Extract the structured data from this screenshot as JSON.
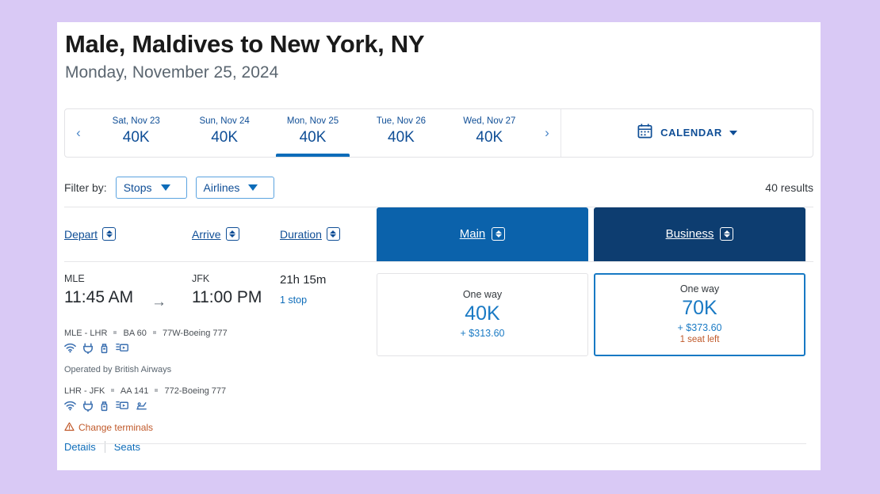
{
  "header": {
    "title": "Male, Maldives to New York, NY",
    "subtitle": "Monday, November 25, 2024"
  },
  "date_strip": {
    "prev_label": "‹",
    "next_label": "›",
    "days": [
      {
        "label": "Sat, Nov 23",
        "price": "40K",
        "selected": false
      },
      {
        "label": "Sun, Nov 24",
        "price": "40K",
        "selected": false
      },
      {
        "label": "Mon, Nov 25",
        "price": "40K",
        "selected": true
      },
      {
        "label": "Tue, Nov 26",
        "price": "40K",
        "selected": false
      },
      {
        "label": "Wed, Nov 27",
        "price": "40K",
        "selected": false
      }
    ],
    "calendar_label": "CALENDAR"
  },
  "filters": {
    "label": "Filter by:",
    "stops_label": "Stops",
    "airlines_label": "Airlines",
    "results_count": "40 results"
  },
  "columns": {
    "depart": "Depart",
    "arrive": "Arrive",
    "duration": "Duration",
    "main": "Main",
    "business": "Business"
  },
  "flight": {
    "depart_code": "MLE",
    "depart_time": "11:45 AM",
    "arrow": "→",
    "arrive_code": "JFK",
    "arrive_time": "11:00 PM",
    "duration": "21h 15m",
    "stops": "1 stop",
    "segment1_route": "MLE - LHR",
    "segment1_flight": "BA 60",
    "segment1_aircraft": "77W-Boeing 777",
    "operated_by": "Operated by British Airways",
    "segment2_route": "LHR - JFK",
    "segment2_flight": "AA 141",
    "segment2_aircraft": "772-Boeing 777",
    "warning": "Change terminals",
    "details_link": "Details",
    "seats_link": "Seats",
    "amenities_leg1": [
      "wifi-icon",
      "power-outlet-icon",
      "usb-port-icon",
      "entertainment-icon"
    ],
    "amenities_leg2": [
      "wifi-icon",
      "power-outlet-icon",
      "usb-port-icon",
      "entertainment-icon",
      "lie-flat-seat-icon"
    ]
  },
  "fares": {
    "main": {
      "trip_type": "One way",
      "miles": "40K",
      "cash": "+ $313.60",
      "seats_left": ""
    },
    "business": {
      "trip_type": "One way",
      "miles": "70K",
      "cash": "+ $373.60",
      "seats_left": "1 seat left"
    }
  },
  "colors": {
    "page_background": "#d9c9f5",
    "main_header": "#0b62ab",
    "business_header": "#0d3d70",
    "link_blue": "#0d6cb9",
    "deep_blue": "#0f4e96",
    "warning_orange": "#c0592a"
  }
}
